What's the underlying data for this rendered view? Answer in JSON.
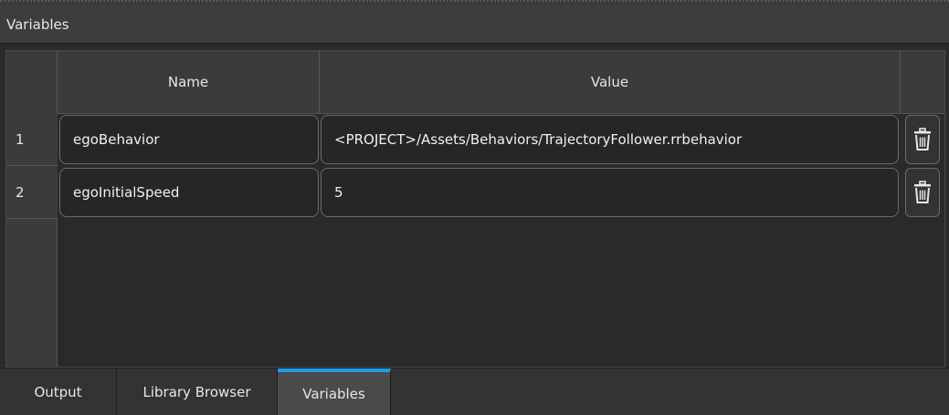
{
  "panel": {
    "title": "Variables"
  },
  "table": {
    "columns": [
      "Name",
      "Value"
    ],
    "rows": [
      {
        "index": "1",
        "name": "egoBehavior",
        "value": "<PROJECT>/Assets/Behaviors/TrajectoryFollower.rrbehavior"
      },
      {
        "index": "2",
        "name": "egoInitialSpeed",
        "value": "5"
      }
    ],
    "delete_icon": "trash-icon"
  },
  "tabs": [
    {
      "label": "Output",
      "active": false
    },
    {
      "label": "Library Browser",
      "active": false
    },
    {
      "label": "Variables",
      "active": true
    }
  ],
  "colors": {
    "accent": "#1e9be9",
    "background": "#2b2b2b"
  }
}
